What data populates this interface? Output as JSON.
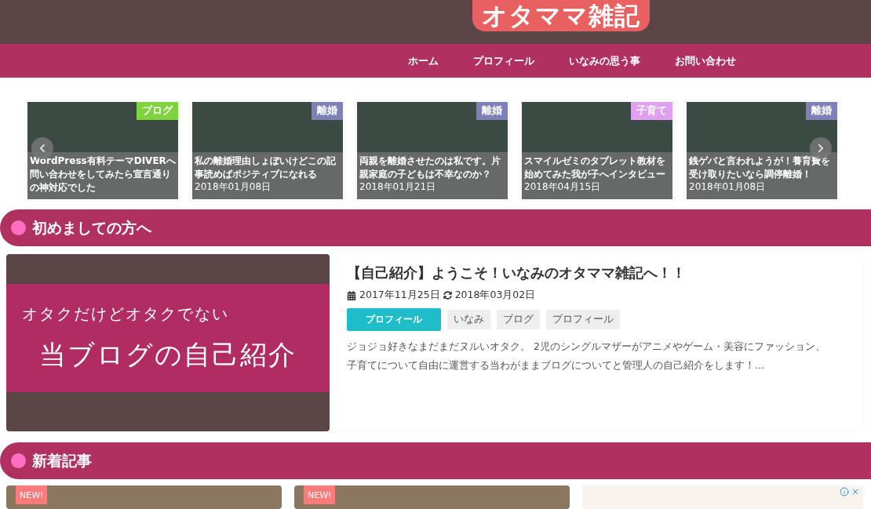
{
  "logo": {
    "text": "オタママ雑記"
  },
  "nav": [
    "ホーム",
    "プロフィール",
    "いなみの思う事",
    "お問い合わせ"
  ],
  "slider": [
    {
      "category": "ブログ",
      "color": "#7fd33c",
      "title": "WordPress有料テーマDIVERへ問い合わせをしてみたら宣言通りの神対応でした"
    },
    {
      "category": "離婚",
      "color": "#8080b8",
      "title": "私の離婚理由しょぼいけどこの記事読めばポジティブになれる",
      "date": "2018年01月08日"
    },
    {
      "category": "離婚",
      "color": "#8080b8",
      "title": "両親を離婚させたのは私です。片親家庭の子どもは不幸なのか？",
      "date": "2018年01月21日"
    },
    {
      "category": "子育て",
      "color": "#e0a0f0",
      "title": "スマイルゼミのタブレット教材を始めてみた我が子へインタビュー",
      "date": "2018年04月15日"
    },
    {
      "category": "離婚",
      "color": "#8080b8",
      "title": "銭ゲバと言われようが！養育費を受け取りたいなら調停離婚！",
      "date": "2018年01月08日"
    }
  ],
  "intro_section": {
    "heading": "初めましての方へ",
    "post": {
      "image_lines": [
        "オタクだけどオタクでない",
        "当ブログの自己紹介"
      ],
      "title": "【自己紹介】ようこそ！いなみのオタママ雑記へ！！",
      "published": "2017年11月25日",
      "updated": "2018年03月02日",
      "category": "プロフィール",
      "tags": [
        "いなみ",
        "ブログ",
        "プロフィール"
      ],
      "excerpt": "ジョジョ好きなまだまだヌルいオタク。 2児のシングルマザーがアニメやゲーム・美容にファッション、子育てについて自由に運営する当わがままブログについてと管理人の自己紹介をします！..."
    }
  },
  "new_section": {
    "heading": "新着記事",
    "cards": [
      {
        "badge": "NEW!"
      },
      {
        "badge": "NEW!"
      }
    ]
  }
}
